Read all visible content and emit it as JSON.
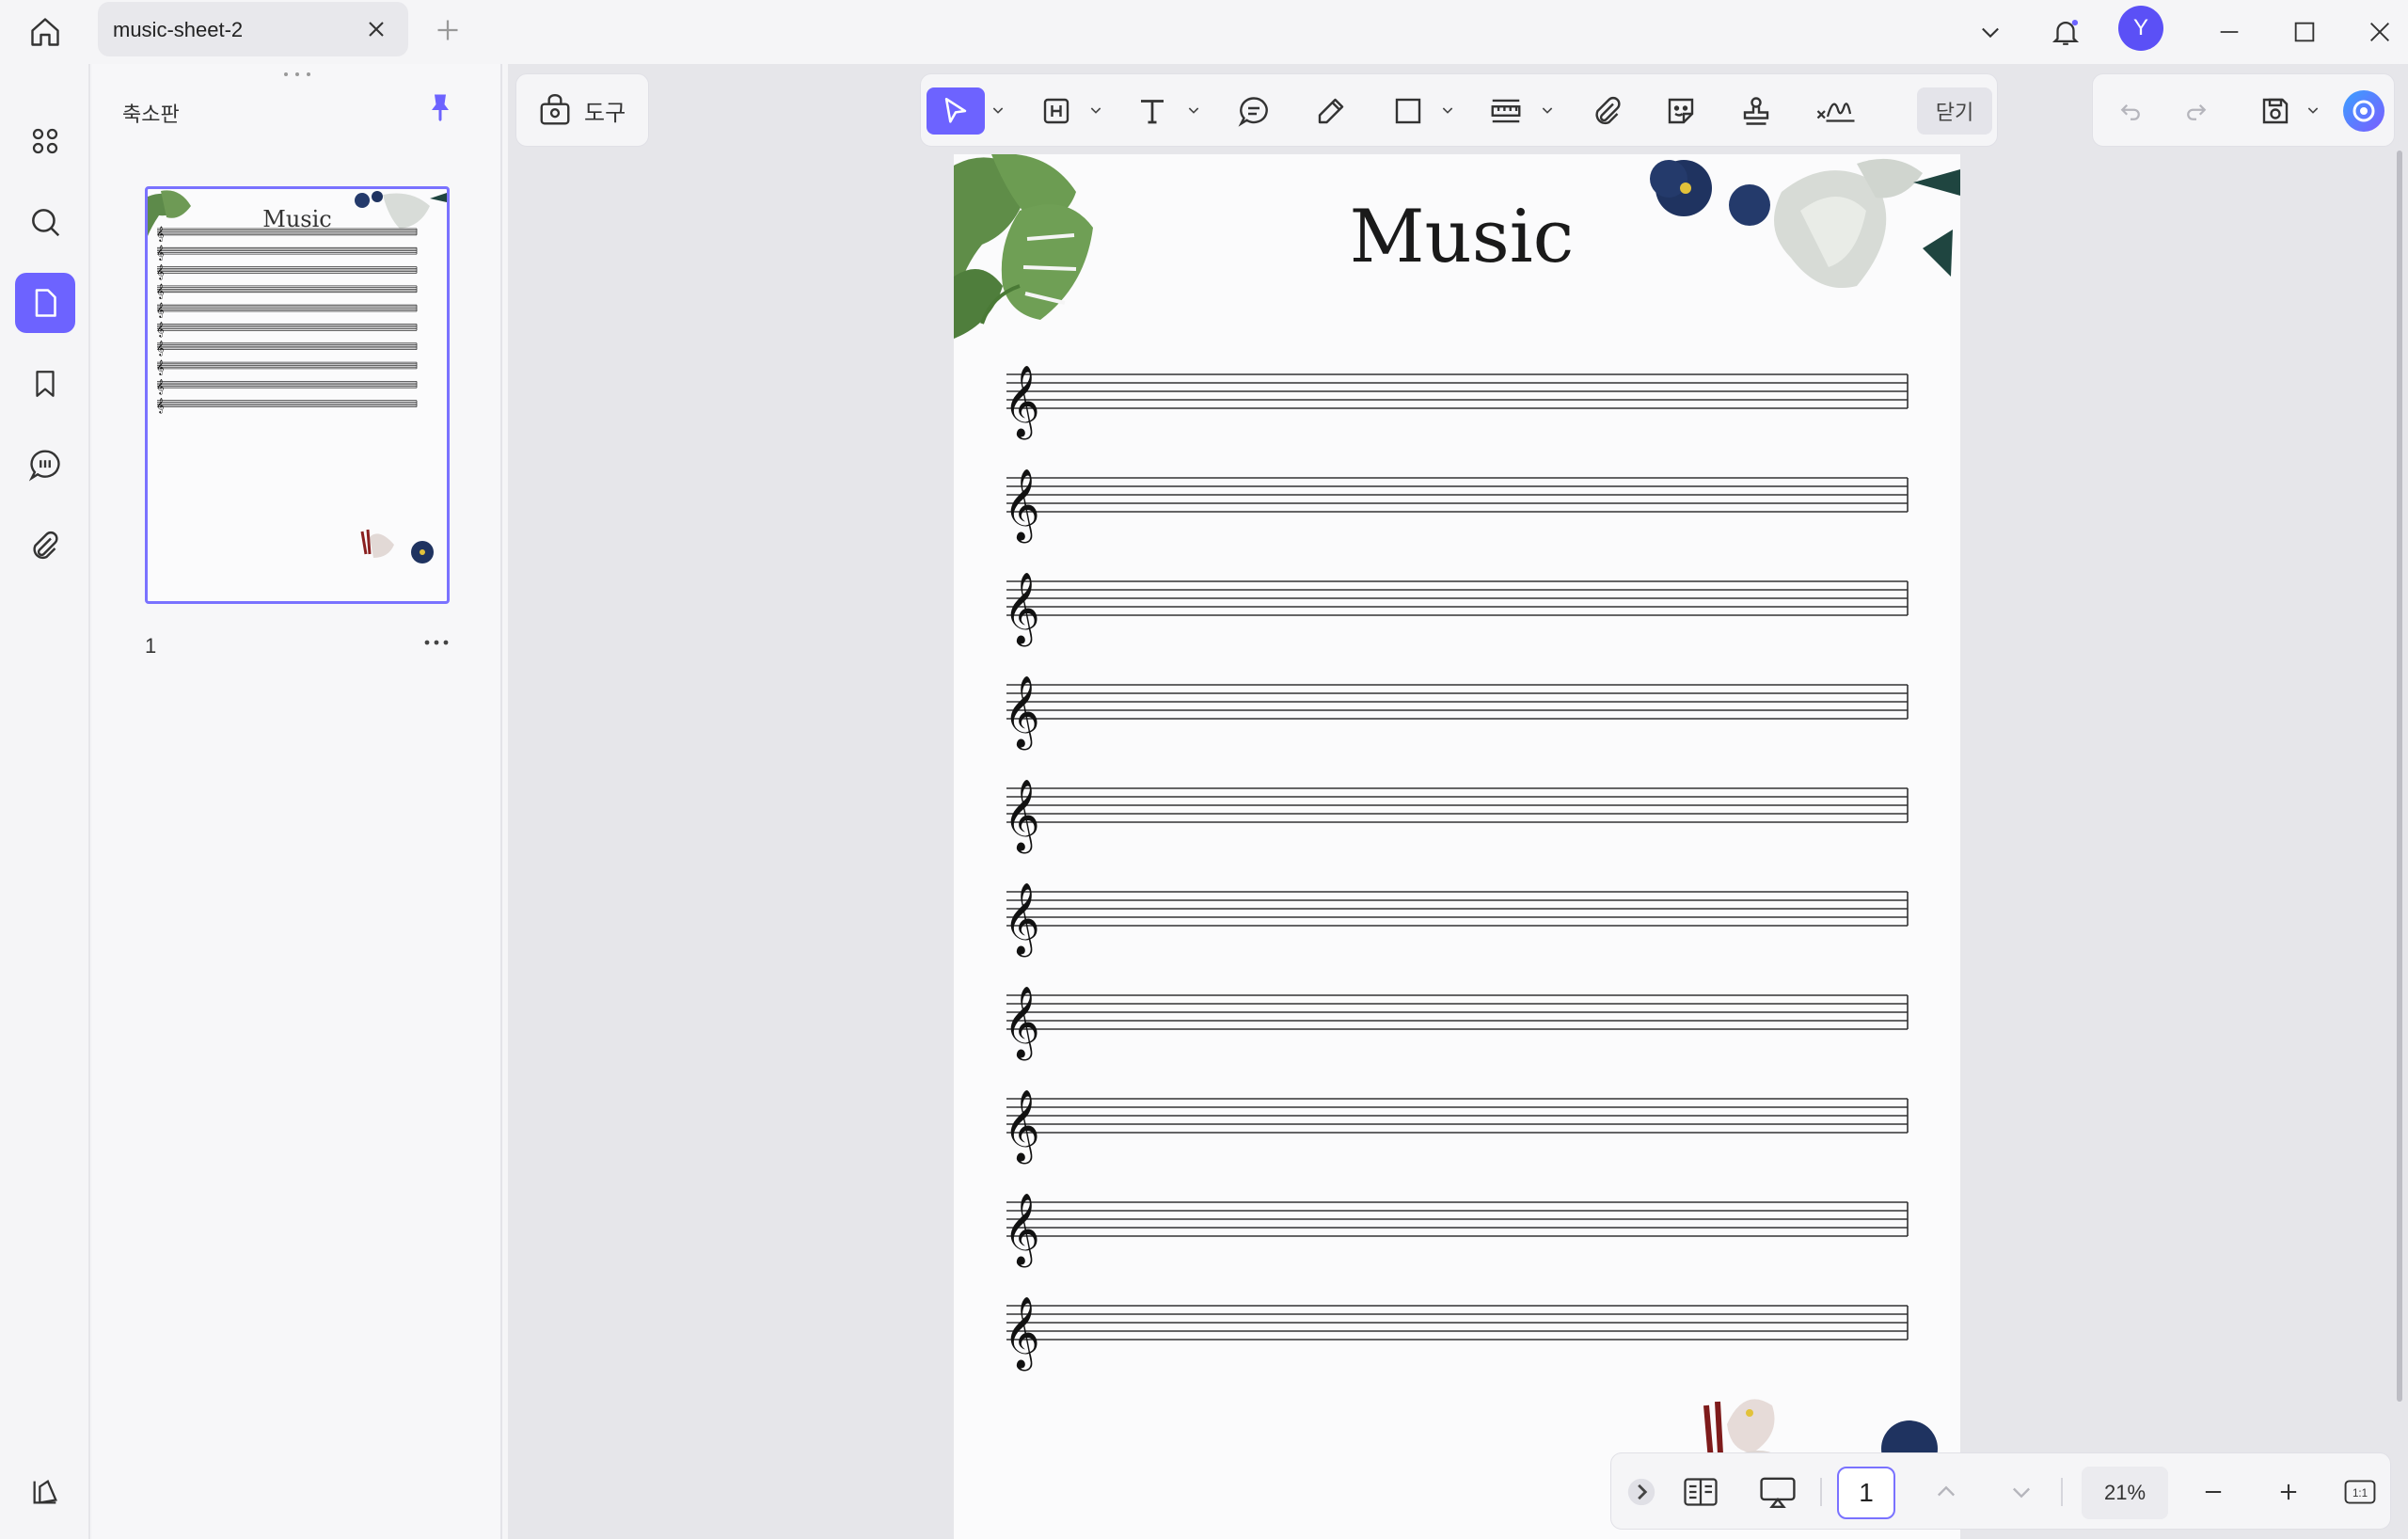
{
  "window": {
    "tab_title": "music-sheet-2",
    "user_initial": "Y"
  },
  "sidebar": {
    "panel_title": "축소판",
    "thumbnail_page_number": "1",
    "thumbnail_title": "Music"
  },
  "toolbar": {
    "tools_label": "도구",
    "close_label": "닫기"
  },
  "document": {
    "title": "Music",
    "staff_count": 10
  },
  "bottom_bar": {
    "current_page": "1",
    "zoom": "21%"
  },
  "colors": {
    "accent": "#6d63ff",
    "avatar": "#5b50f6"
  }
}
